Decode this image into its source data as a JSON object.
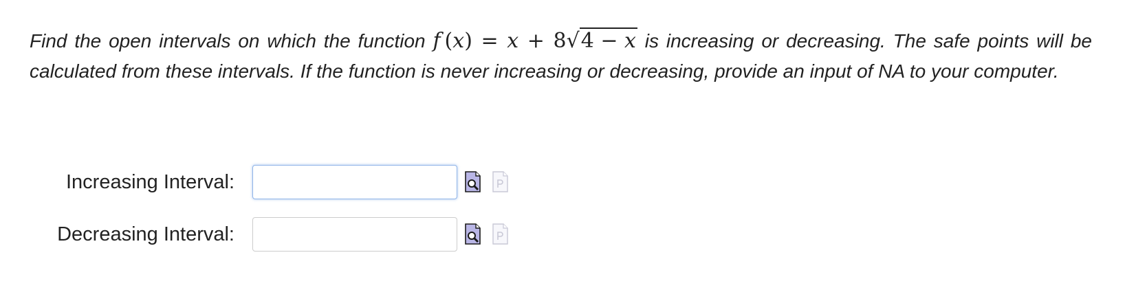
{
  "problem": {
    "text_before": "Find the open intervals on which the function ",
    "math": {
      "f": "f",
      "paren_open": "(",
      "x1": "x",
      "paren_close": ")",
      "equals": " = ",
      "x2": "x",
      "plus": " + 8",
      "radicand_num": "4 − ",
      "radicand_var": "x"
    },
    "text_after": " is increasing or decreasing. The safe points will be calculated from these intervals. If the function is never increasing or decreasing, provide an input of NA to your computer."
  },
  "answers": [
    {
      "label": "Increasing Interval:",
      "value": "",
      "focused": true,
      "preview_icon": "preview-icon",
      "help_icon": "help-icon"
    },
    {
      "label": "Decreasing Interval:",
      "value": "",
      "focused": false,
      "preview_icon": "preview-icon",
      "help_icon": "help-icon"
    }
  ],
  "colors": {
    "text": "#222222",
    "input_border": "#cccccc",
    "input_focus_border": "#8fb4e8",
    "preview_icon_fill": "#b9b6e6",
    "help_icon_stroke": "#c8c8d6"
  }
}
